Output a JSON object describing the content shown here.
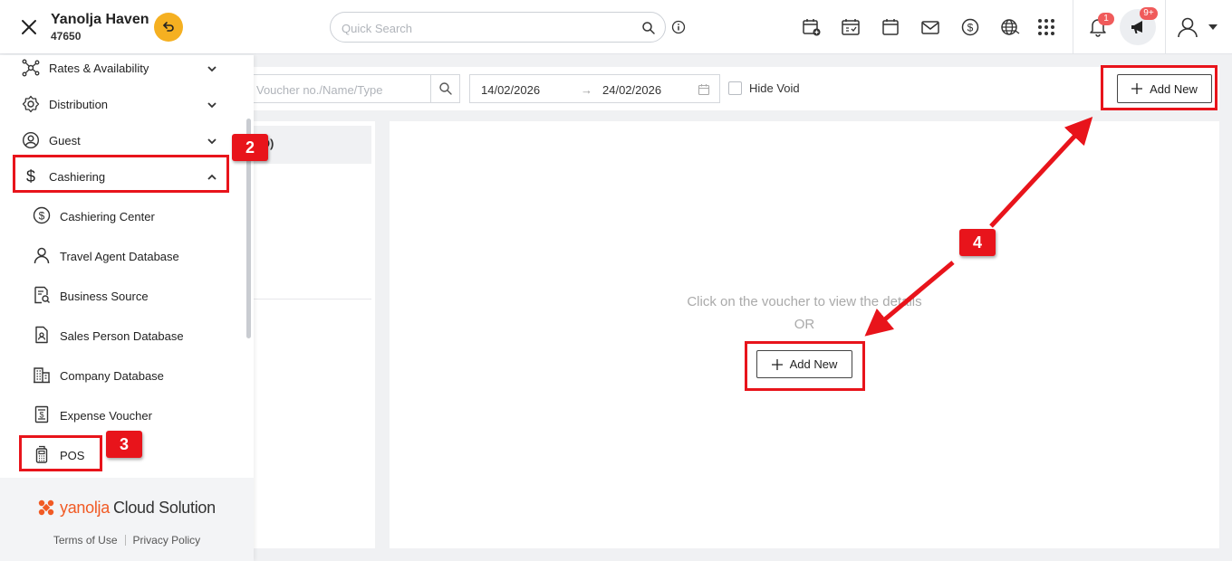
{
  "header": {
    "property_name": "Yanolja Haven",
    "property_id": "47650",
    "search_placeholder": "Quick Search",
    "notification_count": "1",
    "announcement_count": "9+"
  },
  "sidebar": {
    "items": [
      {
        "label": "Rates & Availability",
        "icon": "rates-availability-icon"
      },
      {
        "label": "Distribution",
        "icon": "distribution-icon"
      },
      {
        "label": "Guest",
        "icon": "guest-icon"
      },
      {
        "label": "Cashiering",
        "icon": "dollar-icon",
        "expanded": true
      }
    ],
    "sub_items": [
      {
        "label": "Cashiering Center",
        "icon": "dollar-circle-icon"
      },
      {
        "label": "Travel Agent Database",
        "icon": "person-icon"
      },
      {
        "label": "Business Source",
        "icon": "document-search-icon"
      },
      {
        "label": "Sales Person Database",
        "icon": "id-badge-icon"
      },
      {
        "label": "Company Database",
        "icon": "building-icon"
      },
      {
        "label": "Expense Voucher",
        "icon": "receipt-icon"
      },
      {
        "label": "POS",
        "icon": "pos-terminal-icon"
      }
    ],
    "brand_part1": "yanolja",
    "brand_part2": "Cloud Solution",
    "terms": "Terms of Use",
    "privacy": "Privacy Policy"
  },
  "toolbar": {
    "voucher_search_placeholder": "Voucher no./Name/Type",
    "date_from": "14/02/2026",
    "date_arrow": "→",
    "date_to": "24/02/2026",
    "hide_void_label": "Hide Void",
    "add_new_label": "Add New"
  },
  "left_panel": {
    "row_text": "SD)"
  },
  "main": {
    "empty_message": "Click on the voucher to view the details",
    "or_text": "OR",
    "add_new_label": "Add New"
  },
  "annotations": {
    "step2": "2",
    "step3": "3",
    "step4": "4"
  },
  "colors": {
    "accent": "#f5b021",
    "brand": "#f15a24",
    "annotation": "#e8141b",
    "badge": "#f05b5b"
  }
}
